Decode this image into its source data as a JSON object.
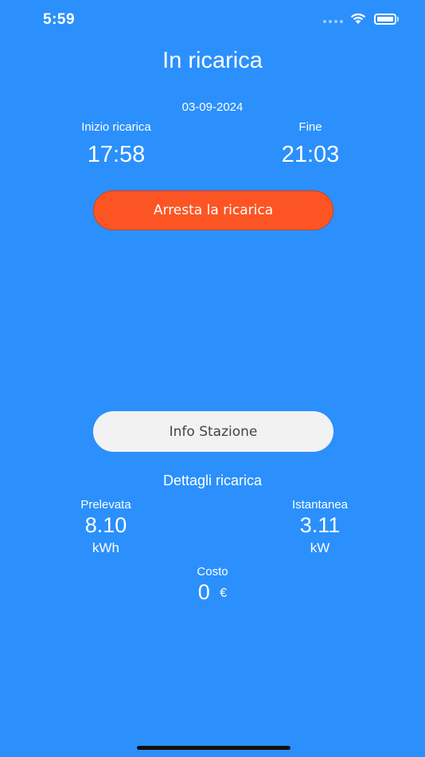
{
  "status_bar": {
    "time": "5:59"
  },
  "header": {
    "title": "In ricarica",
    "date": "03-09-2024"
  },
  "session": {
    "start_label": "Inizio ricarica",
    "start_time": "17:58",
    "end_label": "Fine",
    "end_time": "21:03"
  },
  "actions": {
    "stop_label": "Arresta la ricarica",
    "info_label": "Info Stazione"
  },
  "details": {
    "title": "Dettagli ricarica",
    "withdrawn": {
      "label": "Prelevata",
      "value": "8.10",
      "unit": "kWh"
    },
    "instant": {
      "label": "Istantanea",
      "value": "3.11",
      "unit": "kW"
    },
    "cost": {
      "label": "Costo",
      "value": "0",
      "unit": "€"
    }
  },
  "colors": {
    "background": "#2b90fc",
    "stop_button": "#fc5523",
    "info_button": "#f2f2f2"
  }
}
